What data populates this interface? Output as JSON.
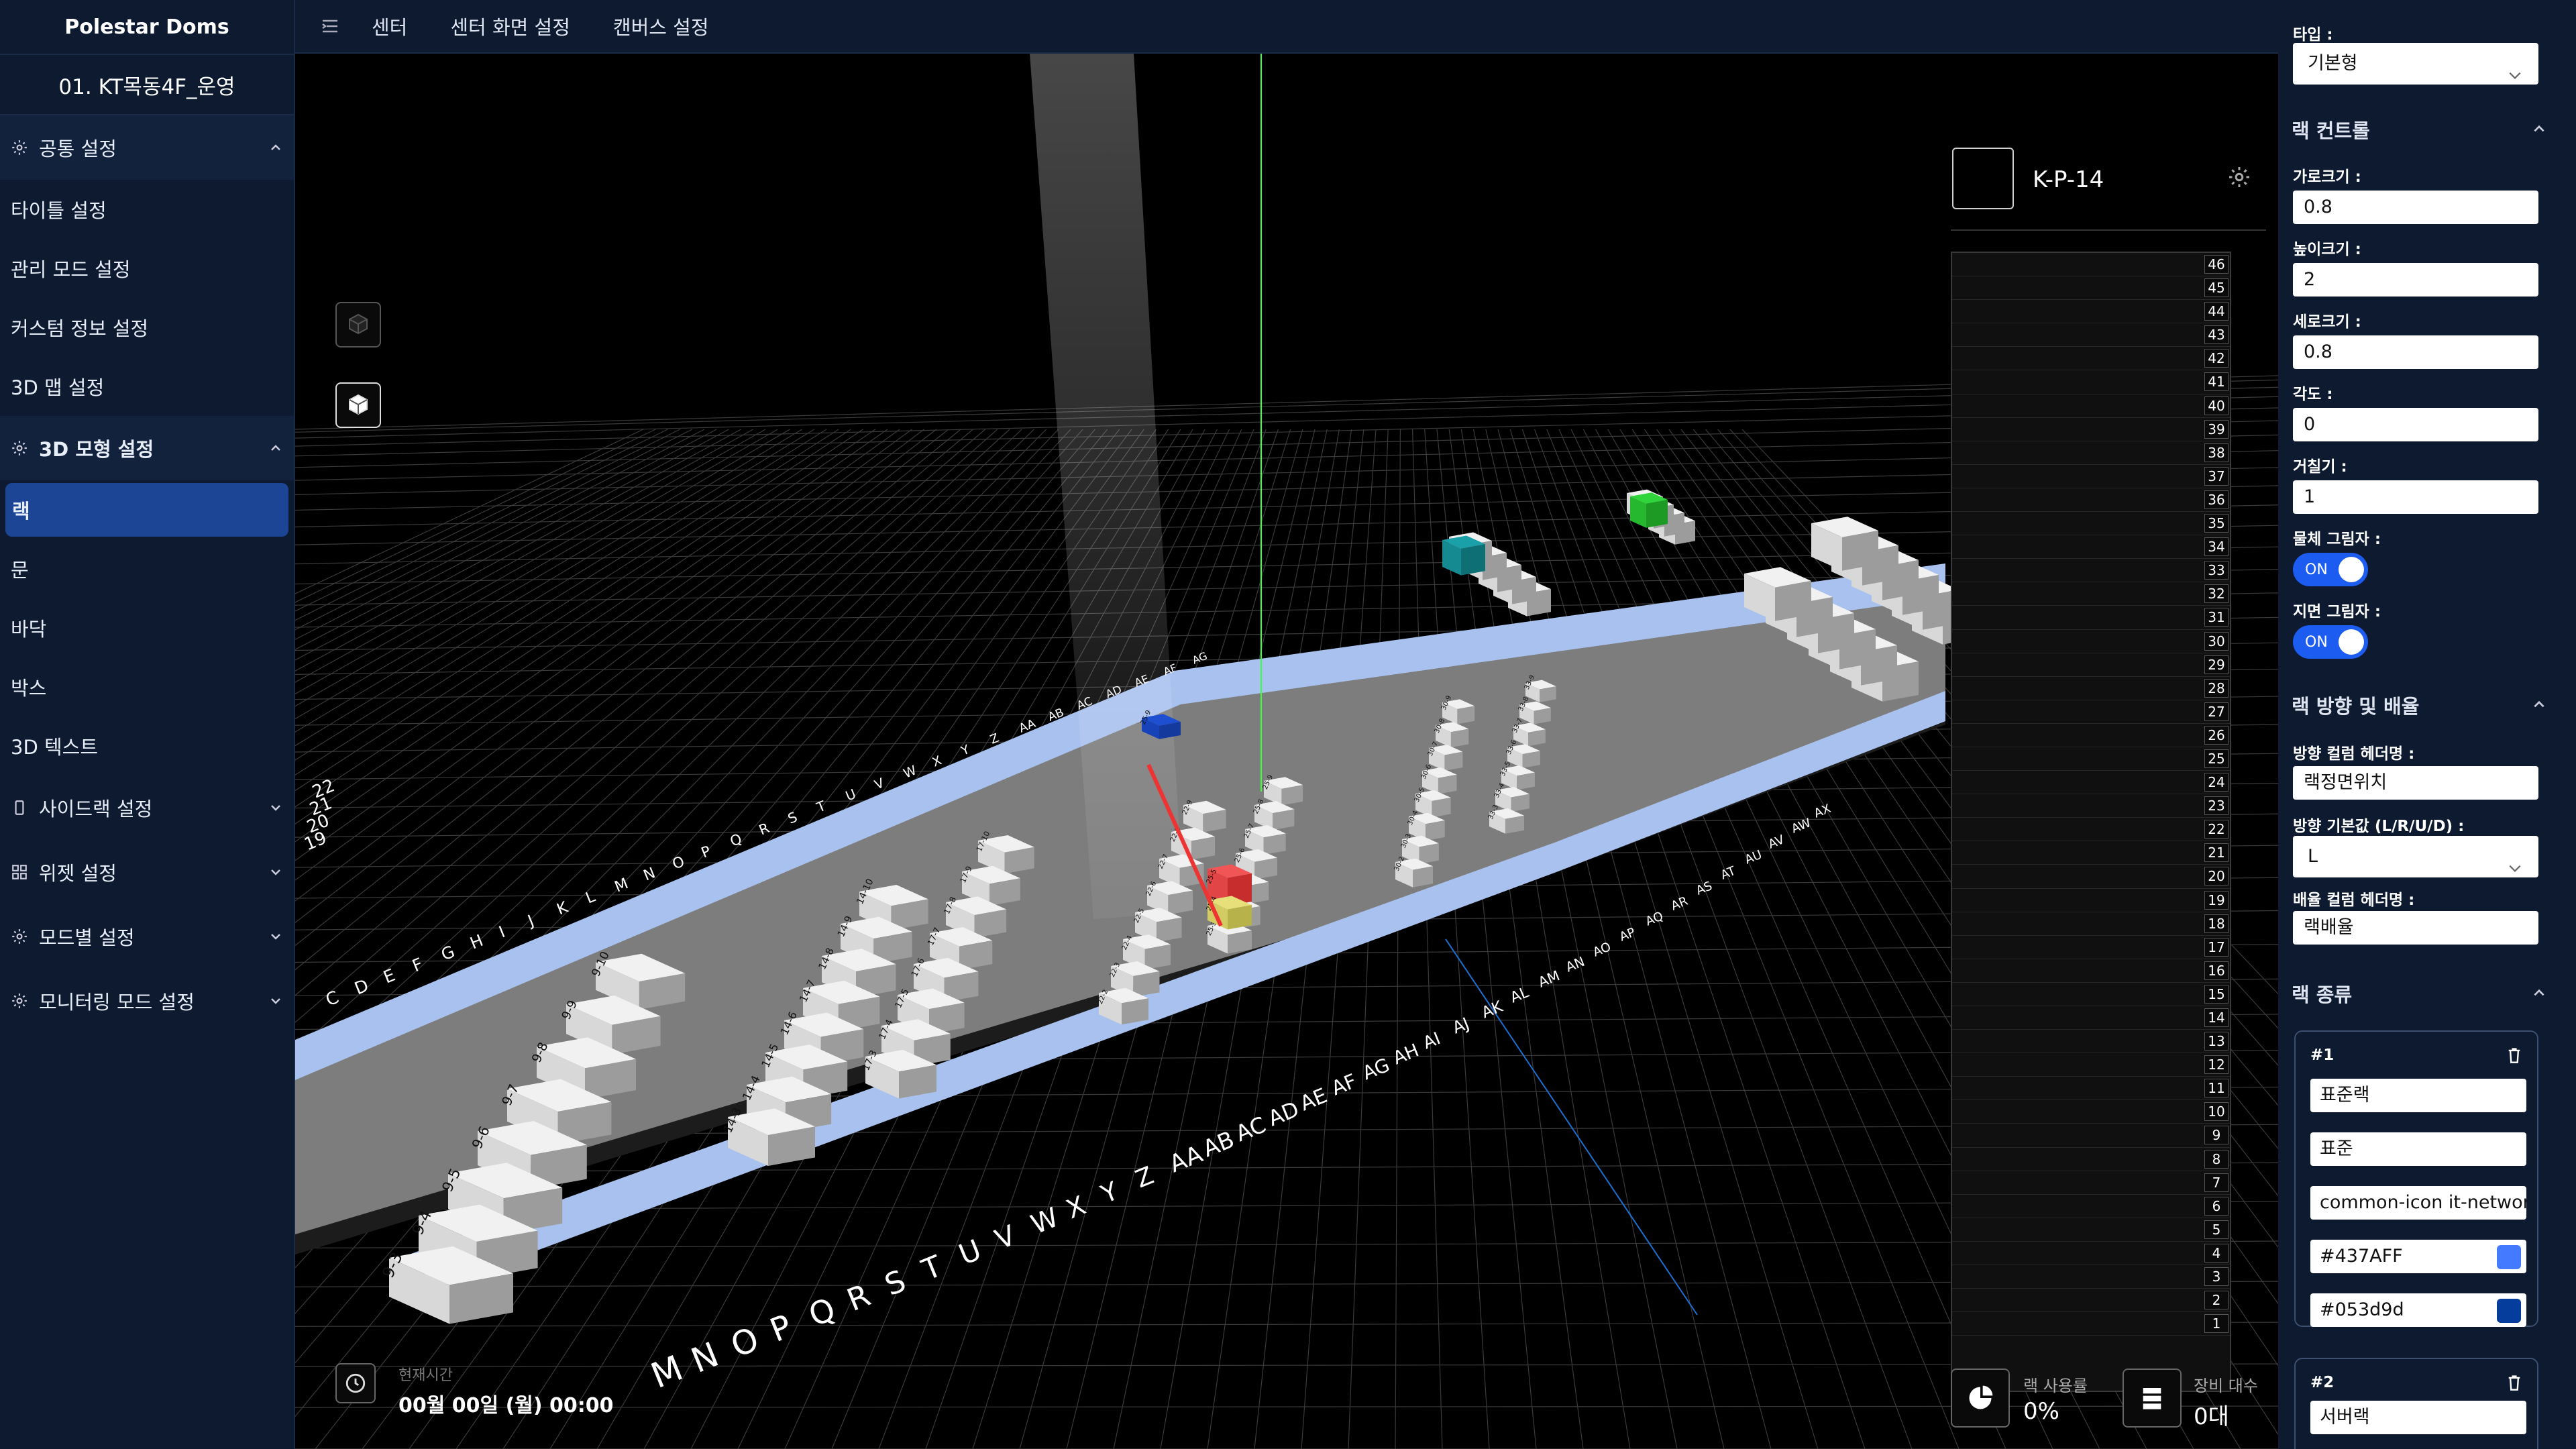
{
  "sidebar": {
    "brand": "Polestar Doms",
    "center_name": "01. KT목동4F_운영",
    "groups": [
      {
        "label": "공통 설정",
        "items": [
          "타이틀 설정",
          "관리 모드 설정",
          "커스텀 정보 설정",
          "3D 맵 설정"
        ]
      },
      {
        "label": "3D 모형 설정",
        "items": [
          "랙",
          "문",
          "바닥",
          "박스",
          "3D 텍스트"
        ]
      },
      {
        "label": "사이드랙 설정"
      },
      {
        "label": "위젯 설정"
      },
      {
        "label": "모드별 설정"
      },
      {
        "label": "모니터링 모드 설정"
      }
    ]
  },
  "topbar": {
    "tabs": [
      "센터",
      "센터 화면 설정",
      "캔버스 설정"
    ]
  },
  "viewport": {
    "rack_name": "K-P-14",
    "rack_units": [
      "46",
      "45",
      "44",
      "43",
      "42",
      "41",
      "40",
      "39",
      "38",
      "37",
      "36",
      "35",
      "34",
      "33",
      "32",
      "31",
      "30",
      "29",
      "28",
      "27",
      "26",
      "25",
      "24",
      "23",
      "22",
      "21",
      "20",
      "19",
      "18",
      "17",
      "16",
      "15",
      "14",
      "13",
      "12",
      "11",
      "10",
      "9",
      "8",
      "7",
      "6",
      "5",
      "4",
      "3",
      "2",
      "1"
    ],
    "time_label": "현재시간",
    "time_value": "00월 00일 (월) 00:00",
    "rack_usage_label": "랙 사용률",
    "rack_usage_value": "0%",
    "equip_count_label": "장비 대수",
    "equip_count_value": "0대",
    "floor_letters_front": [
      "M",
      "N",
      "O",
      "P",
      "Q",
      "R",
      "S",
      "T",
      "U",
      "V",
      "W",
      "X",
      "Y",
      "Z",
      "AA",
      "AB",
      "AC",
      "AD",
      "AE",
      "AF",
      "AG",
      "AH",
      "AI",
      "AJ",
      "AK",
      "AL",
      "AM",
      "AN",
      "AO",
      "AP",
      "AQ",
      "AR",
      "AS",
      "AT",
      "AU",
      "AV",
      "AW",
      "AX"
    ],
    "floor_letters_back": [
      "C",
      "D",
      "E",
      "F",
      "G",
      "H",
      "I",
      "J",
      "K",
      "L",
      "M",
      "N",
      "O",
      "P",
      "Q",
      "R",
      "S",
      "T",
      "U",
      "V",
      "W",
      "X",
      "Y",
      "Z",
      "AA",
      "AB",
      "AC",
      "AD",
      "AE",
      "AF",
      "AG"
    ],
    "row_numbers": [
      "22",
      "21",
      "20",
      "19"
    ],
    "racks": {
      "row9": [
        "9-10",
        "9-9",
        "9-8",
        "9-7",
        "9-6",
        "9-5",
        "9-4",
        "9-3"
      ],
      "row14": [
        "14-10",
        "14-9",
        "14-8",
        "14-7",
        "14-6",
        "14-5",
        "14-4",
        "14-3"
      ],
      "row17": [
        "17-10",
        "17-9",
        "17-8",
        "17-7",
        "17-6",
        "17-5",
        "17-4",
        "17-3"
      ],
      "row22": [
        "22-9",
        "22-8",
        "22-7",
        "22-6",
        "22-5",
        "22-4",
        "22-3",
        "22-2"
      ],
      "row25": [
        "25-9",
        "25-8",
        "25-7",
        "25-6",
        "25-5",
        "25-4",
        "25-3"
      ],
      "row30": [
        "30-9",
        "30-8",
        "30-7",
        "30-6",
        "30-5",
        "30-4",
        "30-3",
        "30-2"
      ],
      "row33": [
        "33-9",
        "33-8",
        "33-7",
        "33-6",
        "33-5",
        "33-4",
        "33-3"
      ]
    }
  },
  "panel": {
    "type_label": "타입 :",
    "type_value": "기본형",
    "rack_control_title": "랙 컨트롤",
    "fields": [
      {
        "label": "가로크기 :",
        "value": "0.8"
      },
      {
        "label": "높이크기 :",
        "value": "2"
      },
      {
        "label": "세로크기 :",
        "value": "0.8"
      },
      {
        "label": "각도 :",
        "value": "0"
      },
      {
        "label": "거칠기 :",
        "value": "1"
      }
    ],
    "object_shadow_label": "물체 그림자 :",
    "object_shadow_value": "ON",
    "ground_shadow_label": "지면 그림자 :",
    "ground_shadow_value": "ON",
    "direction_title": "랙 방향 및 배율",
    "dir_header_label": "방향 컬럼 헤더명 :",
    "dir_header_value": "랙정면위치",
    "dir_default_label": "방향 기본값 (L/R/U/D) :",
    "dir_default_value": "L",
    "scale_header_label": "배율 컬럼 헤더명 :",
    "scale_header_value": "랙배율",
    "rack_types_title": "랙 종류",
    "cards": [
      {
        "index": "#1",
        "name": "표준랙",
        "type": "표준",
        "icon": "common-icon it-network",
        "color1": "#437AFF",
        "color2": "#053d9d"
      },
      {
        "index": "#2",
        "name": "서버랙"
      }
    ]
  },
  "colors": {
    "accent": "#1d5cf0",
    "sidebar_bg": "#0d1a30",
    "aisle": "#9fb8e8",
    "floor": "#7a7a7a"
  }
}
